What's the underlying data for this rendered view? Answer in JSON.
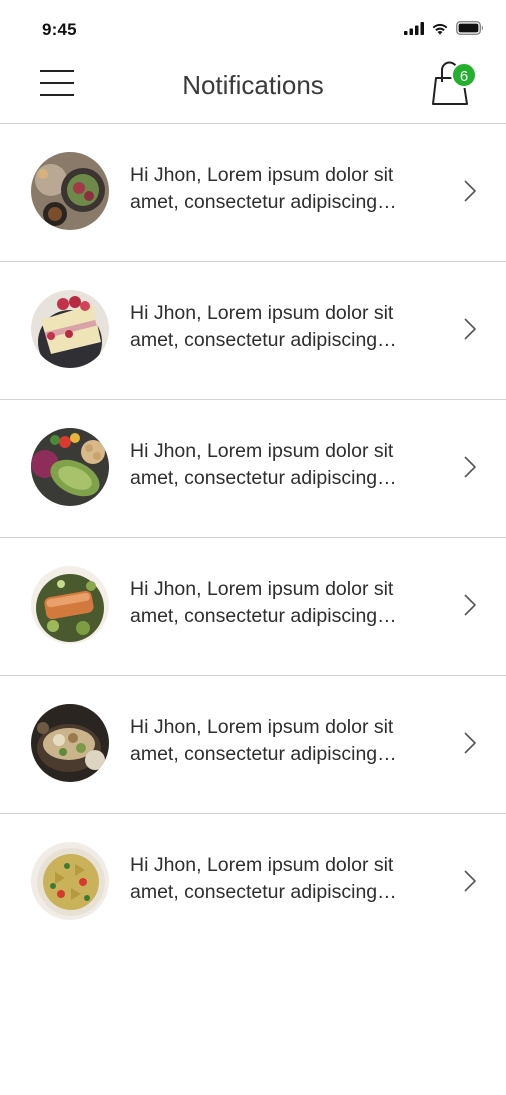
{
  "status_bar": {
    "time": "9:45"
  },
  "header": {
    "title": "Notifications",
    "cart_count": "6"
  },
  "notifications": [
    {
      "line1": "Hi Jhon, Lorem ipsum dolor sit",
      "line2": "amet, consectetur adipiscing…"
    },
    {
      "line1": "Hi Jhon, Lorem ipsum dolor sit",
      "line2": "amet, consectetur adipiscing…"
    },
    {
      "line1": "Hi Jhon, Lorem ipsum dolor sit",
      "line2": "amet, consectetur adipiscing…"
    },
    {
      "line1": "Hi Jhon, Lorem ipsum dolor sit",
      "line2": "amet, consectetur adipiscing…"
    },
    {
      "line1": "Hi Jhon, Lorem ipsum dolor sit",
      "line2": "amet, consectetur adipiscing…"
    },
    {
      "line1": "Hi Jhon, Lorem ipsum dolor sit",
      "line2": "amet, consectetur adipiscing…"
    }
  ],
  "icons": {
    "menu": "hamburger-menu-icon",
    "cart": "shopping-bag-icon",
    "chevron": "chevron-right-icon",
    "signal": "cellular-signal-icon",
    "wifi": "wifi-icon",
    "battery": "battery-icon"
  },
  "colors": {
    "badge": "#22b02e",
    "divider": "#d2d2d2",
    "text": "#2e2e2e"
  }
}
